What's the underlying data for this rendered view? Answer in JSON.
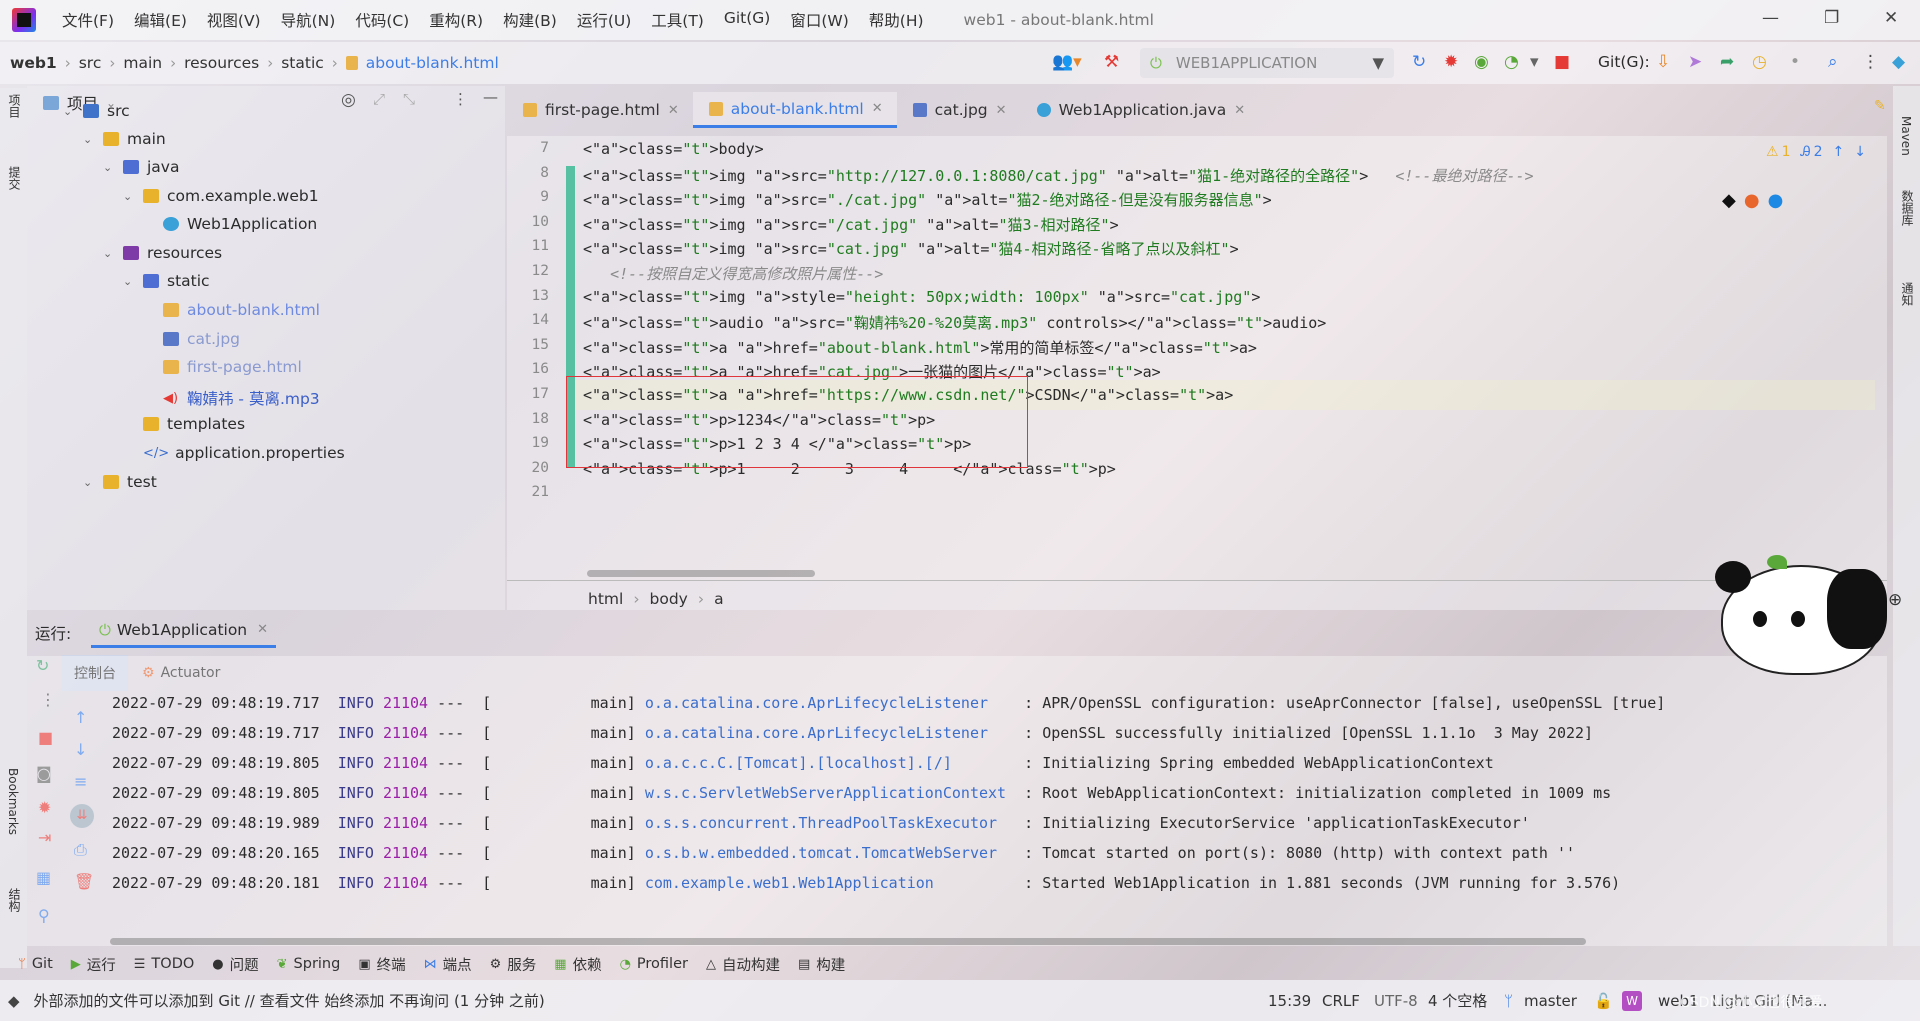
{
  "menu": [
    "文件(F)",
    "编辑(E)",
    "视图(V)",
    "导航(N)",
    "代码(C)",
    "重构(R)",
    "构建(B)",
    "运行(U)",
    "工具(T)",
    "Git(G)",
    "窗口(W)",
    "帮助(H)"
  ],
  "window_title": "web1 - about-blank.html",
  "breadcrumbs": [
    "web1",
    "src",
    "main",
    "resources",
    "static",
    "about-blank.html"
  ],
  "run_config": "WEB1APPLICATION",
  "git_label": "Git(G):",
  "project_panel": {
    "title": "项目"
  },
  "tree": [
    {
      "label": "src",
      "depth": 1,
      "icon": "src"
    },
    {
      "label": "main",
      "depth": 2,
      "icon": "folder"
    },
    {
      "label": "java",
      "depth": 3,
      "icon": "java"
    },
    {
      "label": "com.example.web1",
      "depth": 4,
      "icon": "pkg"
    },
    {
      "label": "Web1Application",
      "depth": 5,
      "icon": "cls"
    },
    {
      "label": "resources",
      "depth": 3,
      "icon": "res"
    },
    {
      "label": "static",
      "depth": 4,
      "icon": "java"
    },
    {
      "label": "about-blank.html",
      "depth": 5,
      "icon": "html"
    },
    {
      "label": "cat.jpg",
      "depth": 5,
      "icon": "img"
    },
    {
      "label": "first-page.html",
      "depth": 5,
      "icon": "html"
    },
    {
      "label": "鞠婧祎 - 莫离.mp3",
      "depth": 5,
      "icon": "mp3"
    },
    {
      "label": "templates",
      "depth": 4,
      "icon": "folder"
    },
    {
      "label": "application.properties",
      "depth": 4,
      "icon": "props"
    },
    {
      "label": "test",
      "depth": 2,
      "icon": "folder"
    }
  ],
  "tabs": [
    {
      "label": "first-page.html",
      "active": false
    },
    {
      "label": "about-blank.html",
      "active": true
    },
    {
      "label": "cat.jpg",
      "active": false
    },
    {
      "label": "Web1Application.java",
      "active": false
    }
  ],
  "code_lines": [
    {
      "n": "7",
      "text": "<body>"
    },
    {
      "n": "8",
      "text": "<img src=\"http://127.0.0.1:8080/cat.jpg\" alt=\"猫1-绝对路径的全路径\">",
      "comment": "<!--最绝对路径-->"
    },
    {
      "n": "9",
      "text": "<img src=\"./cat.jpg\" alt=\"猫2-绝对路径-但是没有服务器信息\">"
    },
    {
      "n": "10",
      "text": "<img src=\"/cat.jpg\" alt=\"猫3-相对路径\">"
    },
    {
      "n": "11",
      "text": "<img src=\"cat.jpg\" alt=\"猫4-相对路径-省略了点以及斜杠\">"
    },
    {
      "n": "12",
      "text": "",
      "comment": "<!--按照自定义得宽高修改照片属性-->"
    },
    {
      "n": "13",
      "text": "<img style=\"height: 50px;width: 100px\" src=\"cat.jpg\">"
    },
    {
      "n": "14",
      "text": "<audio src=\"鞠婧祎%20-%20莫离.mp3\" controls></audio>"
    },
    {
      "n": "15",
      "text": "<a href=\"about-blank.html\">常用的简单标签</a>"
    },
    {
      "n": "16",
      "text": "<a href=\"cat.jpg\">一张猫的图片</a>"
    },
    {
      "n": "17",
      "text": "<a href=\"https://www.csdn.net/\">CSDN</a>"
    },
    {
      "n": "18",
      "text": "<p>1234</p>"
    },
    {
      "n": "19",
      "text": "<p>1 2 3 4 </p>"
    },
    {
      "n": "20",
      "text": "<p>1     2     3     4     </p>"
    },
    {
      "n": "21",
      "text": ""
    }
  ],
  "inspections": {
    "warnings": "1",
    "typos": "2"
  },
  "editor_breadcrumb": [
    "html",
    "body",
    "a"
  ],
  "run_panel": {
    "label": "运行:",
    "config": "Web1Application",
    "tabs": [
      "控制台",
      "Actuator"
    ]
  },
  "logs": [
    {
      "time": "2022-07-29 09:48:19.717",
      "level": "INFO",
      "pid": "21104",
      "thread": "---  [           main]",
      "logger": "o.a.catalina.core.AprLifecycleListener  ",
      "msg": ": APR/OpenSSL configuration: useAprConnector [false], useOpenSSL [true]"
    },
    {
      "time": "2022-07-29 09:48:19.717",
      "level": "INFO",
      "pid": "21104",
      "thread": "---  [           main]",
      "logger": "o.a.catalina.core.AprLifecycleListener  ",
      "msg": ": OpenSSL successfully initialized [OpenSSL 1.1.1o  3 May 2022]"
    },
    {
      "time": "2022-07-29 09:48:19.805",
      "level": "INFO",
      "pid": "21104",
      "thread": "---  [           main]",
      "logger": "o.a.c.c.C.[Tomcat].[localhost].[/]      ",
      "msg": ": Initializing Spring embedded WebApplicationContext"
    },
    {
      "time": "2022-07-29 09:48:19.805",
      "level": "INFO",
      "pid": "21104",
      "thread": "---  [           main]",
      "logger": "w.s.c.ServletWebServerApplicationContext",
      "msg": ": Root WebApplicationContext: initialization completed in 1009 ms"
    },
    {
      "time": "2022-07-29 09:48:19.989",
      "level": "INFO",
      "pid": "21104",
      "thread": "---  [           main]",
      "logger": "o.s.s.concurrent.ThreadPoolTaskExecutor ",
      "msg": ": Initializing ExecutorService 'applicationTaskExecutor'"
    },
    {
      "time": "2022-07-29 09:48:20.165",
      "level": "INFO",
      "pid": "21104",
      "thread": "---  [           main]",
      "logger": "o.s.b.w.embedded.tomcat.TomcatWebServer ",
      "msg": ": Tomcat started on port(s): 8080 (http) with context path ''"
    },
    {
      "time": "2022-07-29 09:48:20.181",
      "level": "INFO",
      "pid": "21104",
      "thread": "---  [           main]",
      "logger": "com.example.web1.Web1Application        ",
      "msg": ": Started Web1Application in 1.881 seconds (JVM running for 3.576)"
    }
  ],
  "tool_windows": [
    "Git",
    "运行",
    "TODO",
    "问题",
    "Spring",
    "终端",
    "端点",
    "服务",
    "依赖",
    "Profiler",
    "自动构建",
    "构建"
  ],
  "left_strip": [
    "项目",
    "提交",
    "Bookmarks",
    "结构"
  ],
  "right_strip": [
    "Maven",
    "数据库",
    "通知"
  ],
  "status": {
    "message": "外部添加的文件可以添加到 Git // 查看文件   始终添加   不再询问 (1 分钟 之前)",
    "position": "15:39",
    "line_sep": "CRLF",
    "encoding": "UTF-8",
    "indent": "4 个空格",
    "branch": "master",
    "project": "web1",
    "theme": "Light Girl (Ma...",
    "watermark": "CSDN @小乂也很可爱"
  }
}
